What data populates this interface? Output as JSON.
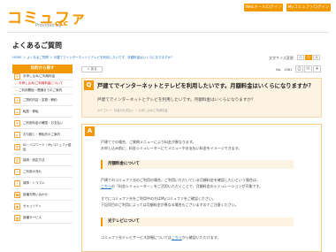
{
  "header": {
    "logo": "コミュファ",
    "logo_tagline": "Provided by",
    "logo_brand": "ctc",
    "buttons": [
      "Webメールログイン",
      "Myコミュファログイン"
    ]
  },
  "page": {
    "title": "よくあるご質問",
    "breadcrumb": "HOME  ＞ よくあるご質問 ＞ 戸建てでインターネットとテレビを利用したいです。月額料金はいくらになりますか？",
    "font_size_label": "文字サイズ変更",
    "font_sizes": [
      "小",
      "中",
      "大"
    ]
  },
  "sidebar": {
    "heading": "目的から探す",
    "items": [
      {
        "label": "お申し込み/ご利用料金",
        "sub": false
      },
      {
        "label": "お申し込み/ご利用料金について",
        "sub": true
      },
      {
        "label": "ご利用開始・開通までのご案内",
        "sub": true
      },
      {
        "label": "ご契約内容・変更・解約",
        "sub": false
      },
      {
        "label": "転居・移転",
        "sub": false
      },
      {
        "label": "ご利用料金の確認・お支払い",
        "sub": false
      },
      {
        "label": "お引越し・移転先のご案内",
        "sub": false
      },
      {
        "label": "ID・パスワード・Myコミュファ認証",
        "sub": false
      },
      {
        "label": "接続・設定方法",
        "sub": false
      },
      {
        "label": "ご利用の流れ",
        "sub": false
      },
      {
        "label": "故障・トラブル",
        "sub": false
      },
      {
        "label": "各種お問い合わせ",
        "sub": false
      },
      {
        "label": "セキュリティ",
        "sub": false
      },
      {
        "label": "各種サービス",
        "sub": false
      }
    ]
  },
  "main": {
    "back_label": "＜ 戻る",
    "number_label": "No：1961",
    "question_badge": "Q",
    "question_title": "戸建てでインターネットとテレビを利用したいです。月額料金はいくらになりますか？",
    "question_sub": "戸建てでインターネットとテレビを利用したいです。月額料金はいくらになりますか？",
    "question_category": "カテゴリー：料金のお支払い ＞ お申し込み/ご利用料金",
    "answer_badge": "A",
    "answer_intro_1": "戸建てでの場合、ご質問メニューにより料金が異なります。",
    "answer_intro_2": "お申し込み前に、料金シミュレーターにてメニューやお支払い料金をイメージできます。",
    "section1_title": "月額料金について",
    "section1_p1": "戸建てのコミュファ光のご利用の場合、ご利用いただいている月額料金を確認したいという場合は、",
    "section1_link": "こちら",
    "section1_p2": "の「料金シミュレーター」をご活用いただくことで、月額料金のシミュレーションが可能です。",
    "section1_p3": "すでにコミュファ光をご利用中の方はMyコミュファをご確認ください。",
    "section1_p4": "下記项目のご利用によっては月額料金が異なる場合もございますのでご注意ください。",
    "section2_title": "光テレビについて",
    "section2_p1": "コミュファ光テレビサービス詳細については",
    "section2_link": "こちら",
    "section2_p2": "から確認いただけます。"
  },
  "colors": {
    "accent": "#f39800",
    "link": "#1e6fc2",
    "highlight_bg": "#fdf3e3"
  }
}
